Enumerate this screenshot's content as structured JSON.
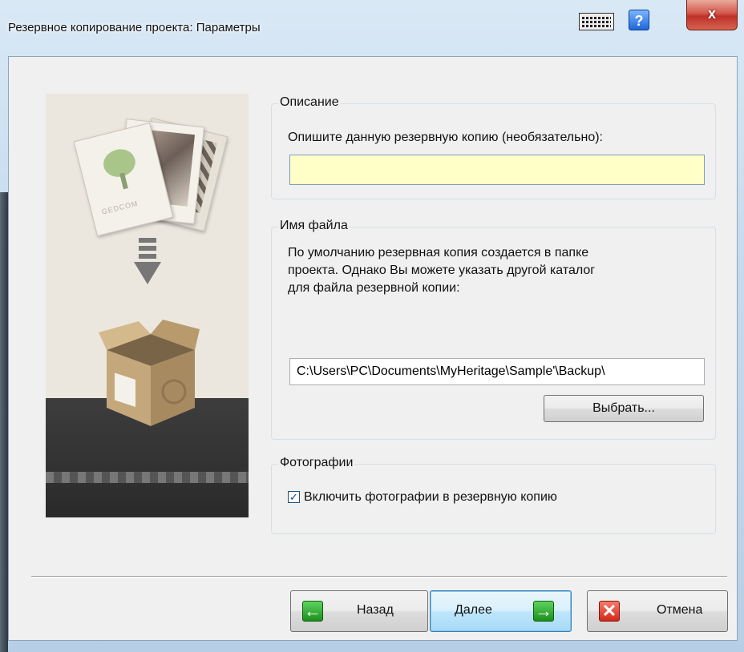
{
  "window": {
    "title": "Резервное копирование проекта: Параметры",
    "help_label": "?",
    "close_label": "x"
  },
  "description_group": {
    "title": "Описание",
    "prompt": "Опишите данную резервную копию (необязательно):",
    "input_value": ""
  },
  "filename_group": {
    "title": "Имя файла",
    "text_line1": "По умолчанию резервная копия создается в папке",
    "text_line2": "проекта. Однако Вы можете указать другой каталог",
    "text_line3": "для файла резервной копии:",
    "path_value": "C:\\Users\\PC\\Documents\\MyHeritage\\Sample'\\Backup\\",
    "browse_label": "Выбрать..."
  },
  "photos_group": {
    "title": "Фотографии",
    "checkbox_label": "Включить фотографии в резервную копию",
    "checkbox_checked": true
  },
  "footer": {
    "back_label": "Назад",
    "next_label": "Далее",
    "cancel_label": "Отмена"
  },
  "illustration": {
    "card_text": "GEDCOM"
  },
  "colors": {
    "input_highlight": "#ffffc8",
    "accent_blue": "#3c7fb1"
  }
}
